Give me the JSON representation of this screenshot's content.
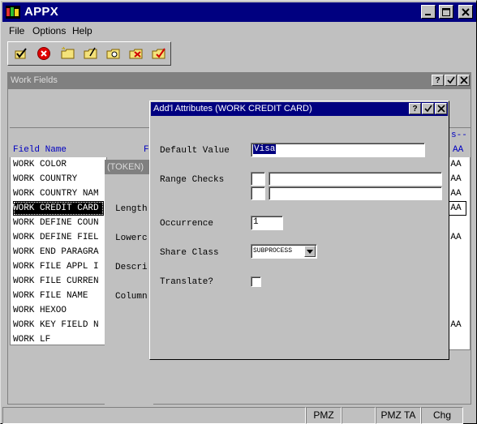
{
  "window": {
    "title": "APPX"
  },
  "menu": [
    "File",
    "Options",
    "Help"
  ],
  "toolbar": {
    "icons": [
      "checkmark-icon",
      "cancel-icon",
      "folder-new-icon",
      "folder-edit-icon",
      "folder-search-icon",
      "folder-delete-icon",
      "folder-check-icon"
    ]
  },
  "work_fields": {
    "title": "Work Fields",
    "col_field_name": "Field Name",
    "col_f": "F",
    "col_right_header": "s--",
    "col_right_sub": "AA",
    "rows": [
      {
        "name": "WORK COLOR",
        "flag": "AA"
      },
      {
        "name": "WORK COUNTRY",
        "flag": "AA"
      },
      {
        "name": "WORK COUNTRY NAM",
        "flag": "AA"
      },
      {
        "name": "WORK CREDIT CARD",
        "flag": "AA"
      },
      {
        "name": "WORK DEFINE COUN",
        "flag": ""
      },
      {
        "name": "WORK DEFINE FIEL",
        "flag": "AA"
      },
      {
        "name": "WORK END PARAGRA",
        "flag": ""
      },
      {
        "name": "WORK FILE APPL I",
        "flag": ""
      },
      {
        "name": "WORK FILE CURREN",
        "flag": ""
      },
      {
        "name": "WORK FILE NAME",
        "flag": ""
      },
      {
        "name": "WORK HEXOO",
        "flag": ""
      },
      {
        "name": "WORK KEY FIELD N",
        "flag": "AA"
      },
      {
        "name": "WORK LF",
        "flag": ""
      }
    ]
  },
  "token_window": {
    "title": "(TOKEN)",
    "labels": [
      "Length",
      "Lowerc",
      "Descri",
      "Column"
    ]
  },
  "dialog": {
    "title": "Add'l Attributes (WORK CREDIT CARD)",
    "default_value_label": "Default Value",
    "default_value": "Visa",
    "range_checks_label": "Range Checks",
    "occurrence_label": "Occurrence",
    "occurrence_value": "1",
    "share_class_label": "Share Class",
    "share_class_value": "SUBPROCESS",
    "translate_label": "Translate?"
  },
  "status": [
    "PMZ",
    "PMZ TA",
    "Chg"
  ]
}
